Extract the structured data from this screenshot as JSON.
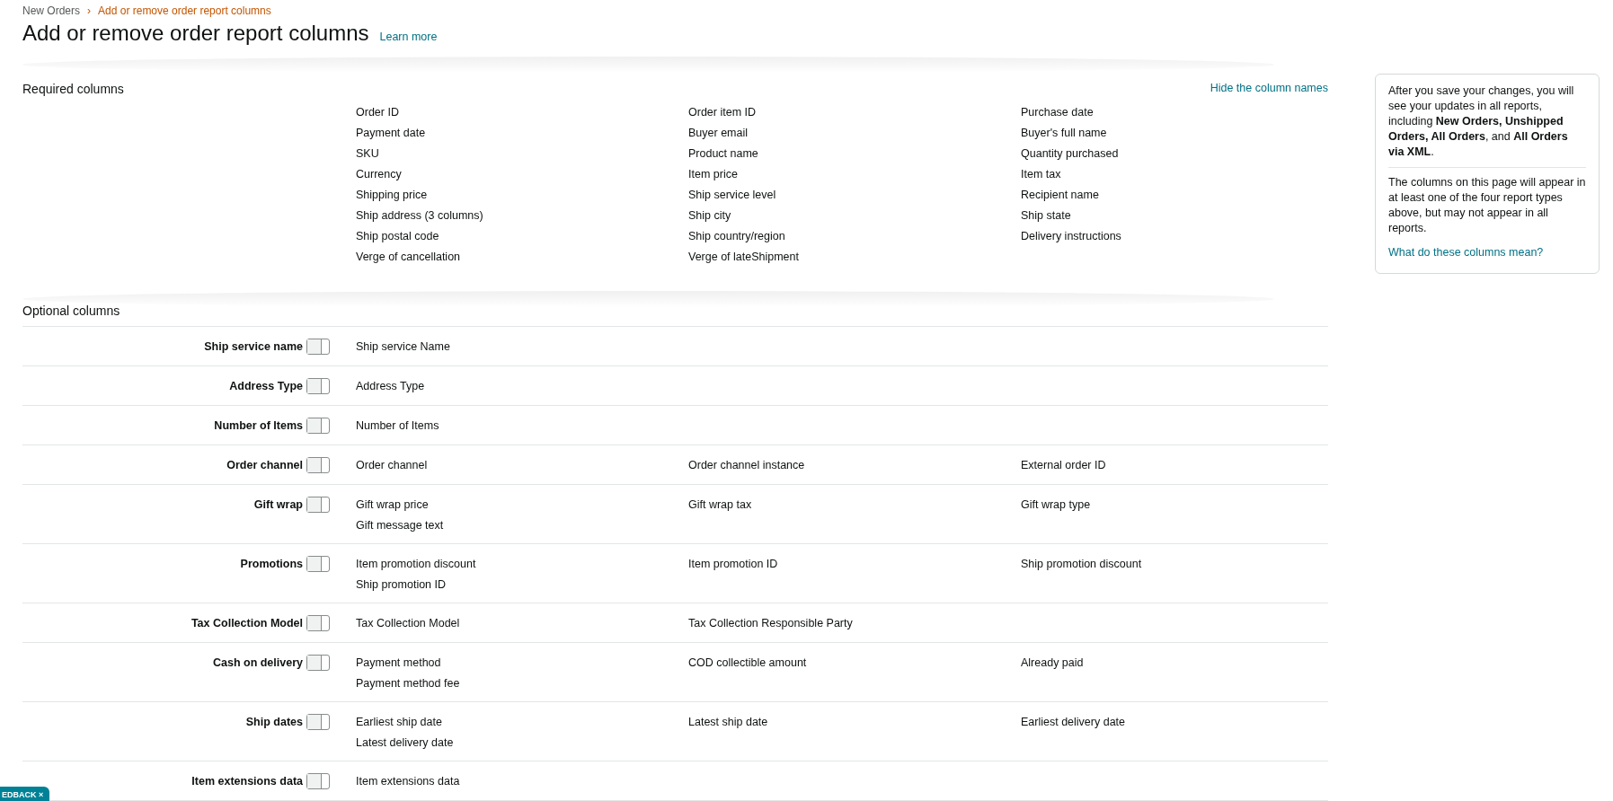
{
  "breadcrumb": [
    {
      "label": "New Orders",
      "current": false
    },
    {
      "label": "Add or remove order report columns",
      "current": true
    }
  ],
  "breadcrumb_separator": "›",
  "title": "Add or remove order report columns",
  "learn_more": "Learn more",
  "required": {
    "heading": "Required columns",
    "hide_link": "Hide the column names",
    "columns": [
      "Order ID",
      "Order item ID",
      "Purchase date",
      "Payment date",
      "Buyer email",
      "Buyer's full name",
      "SKU",
      "Product name",
      "Quantity purchased",
      "Currency",
      "Item price",
      "Item tax",
      "Shipping price",
      "Ship service level",
      "Recipient name",
      "Ship address (3 columns)",
      "Ship city",
      "Ship state",
      "Ship postal code",
      "Ship country/region",
      "Delivery instructions",
      "Verge of cancellation",
      "Verge of lateShipment"
    ]
  },
  "optional": {
    "heading": "Optional columns",
    "groups": [
      {
        "label": "Ship service name",
        "on": false,
        "columns": [
          "Ship service Name"
        ]
      },
      {
        "label": "Address Type",
        "on": false,
        "columns": [
          "Address Type"
        ]
      },
      {
        "label": "Number of Items",
        "on": false,
        "columns": [
          "Number of Items"
        ]
      },
      {
        "label": "Order channel",
        "on": false,
        "columns": [
          "Order channel",
          "Order channel instance",
          "External order ID"
        ]
      },
      {
        "label": "Gift wrap",
        "on": false,
        "columns": [
          "Gift wrap price",
          "Gift wrap tax",
          "Gift wrap type",
          "Gift message text"
        ]
      },
      {
        "label": "Promotions",
        "on": false,
        "columns": [
          "Item promotion discount",
          "Item promotion ID",
          "Ship promotion discount",
          "Ship promotion ID"
        ]
      },
      {
        "label": "Tax Collection Model",
        "on": false,
        "columns": [
          "Tax Collection Model",
          "Tax Collection Responsible Party"
        ]
      },
      {
        "label": "Cash on delivery",
        "on": false,
        "columns": [
          "Payment method",
          "COD collectible amount",
          "Already paid",
          "Payment method fee"
        ]
      },
      {
        "label": "Ship dates",
        "on": false,
        "columns": [
          "Earliest ship date",
          "Latest ship date",
          "Earliest delivery date",
          "Latest delivery date"
        ]
      },
      {
        "label": "Item extensions data",
        "on": false,
        "columns": [
          "Item extensions data"
        ]
      }
    ]
  },
  "info": {
    "paragraph_1": "After you save your changes, you will see your updates in all reports, including **New Orders, Unshipped Orders, All Orders**, and **All Orders via XML**.",
    "paragraph_2": "The columns on this page will appear in at least one of the four report types above, but may not appear in all reports.",
    "link": "What do these columns mean?"
  },
  "feedback": {
    "label": "EDBACK",
    "close": "×"
  }
}
